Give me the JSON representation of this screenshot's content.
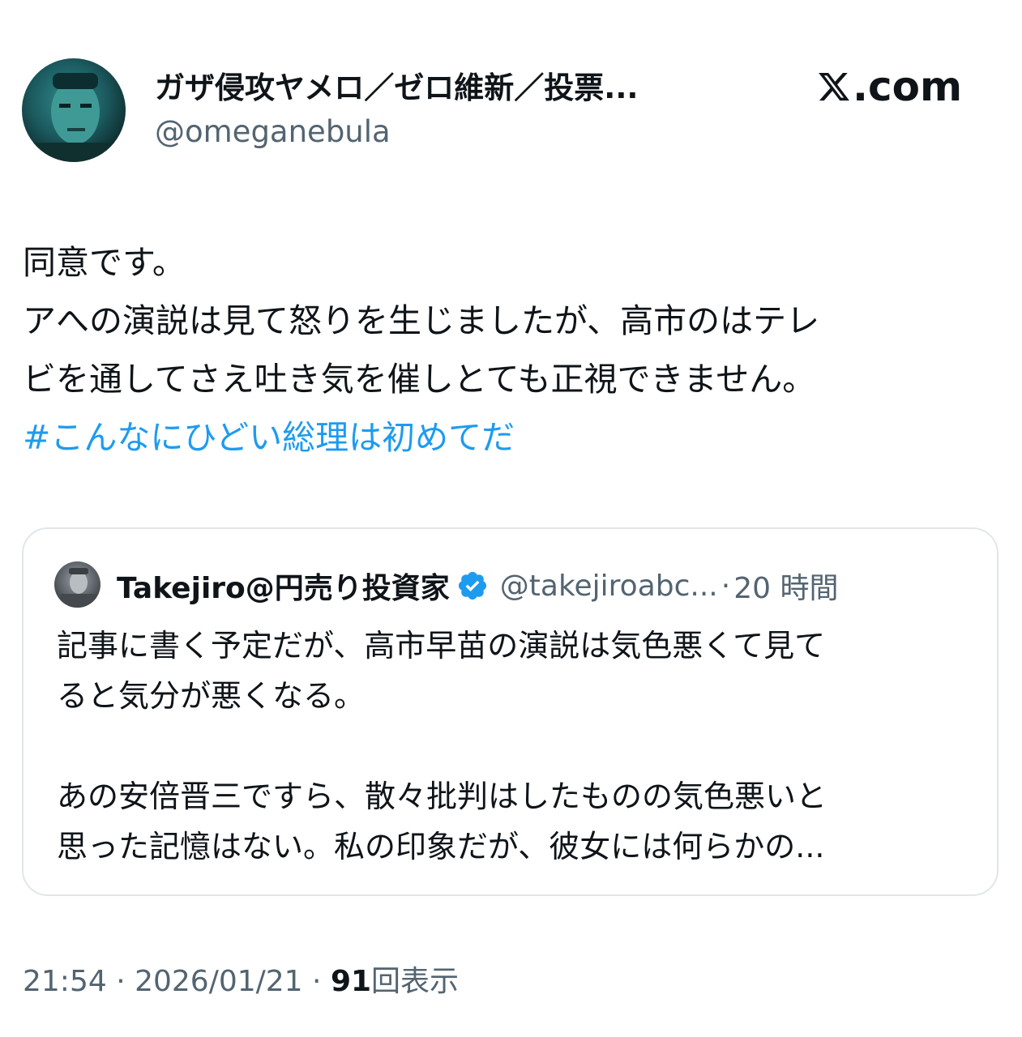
{
  "author": {
    "display_name": "ガザ侵攻ヤメロ／ゼロ維新／投票...",
    "handle": "@omeganebula",
    "avatar_icon": "profile-photo"
  },
  "brand": {
    "logo_text": ".com",
    "logo_icon": "x-logo-icon"
  },
  "tweet": {
    "lines": [
      "同意です。",
      "アへの演説は見て怒りを生じましたが、高市のはテレ",
      "ビを通してさえ吐き気を催しとても正視できません。"
    ],
    "hashtag": "#こんなにひどい総理は初めてだ"
  },
  "quote": {
    "name": "Takejiro@円売り投資家",
    "handle": "@takejiroabc...",
    "separator": "·",
    "time": "20 時間",
    "verified_icon": "verified-badge-icon",
    "paragraph1": [
      "記事に書く予定だが、高市早苗の演説は気色悪くて見て",
      "ると気分が悪くなる。"
    ],
    "paragraph2": [
      "あの安倍晋三ですら、散々批判はしたものの気色悪いと",
      "思った記憶はない。私の印象だが、彼女には何らかの..."
    ]
  },
  "meta": {
    "time": "21:54",
    "sep1": " · ",
    "date": "2026/01/21",
    "sep2": " · ",
    "views": "91",
    "views_label": "回表示"
  },
  "colors": {
    "text": "#0f1419",
    "secondary": "#536471",
    "link": "#1d9bf0",
    "border": "#e1e6ea"
  }
}
